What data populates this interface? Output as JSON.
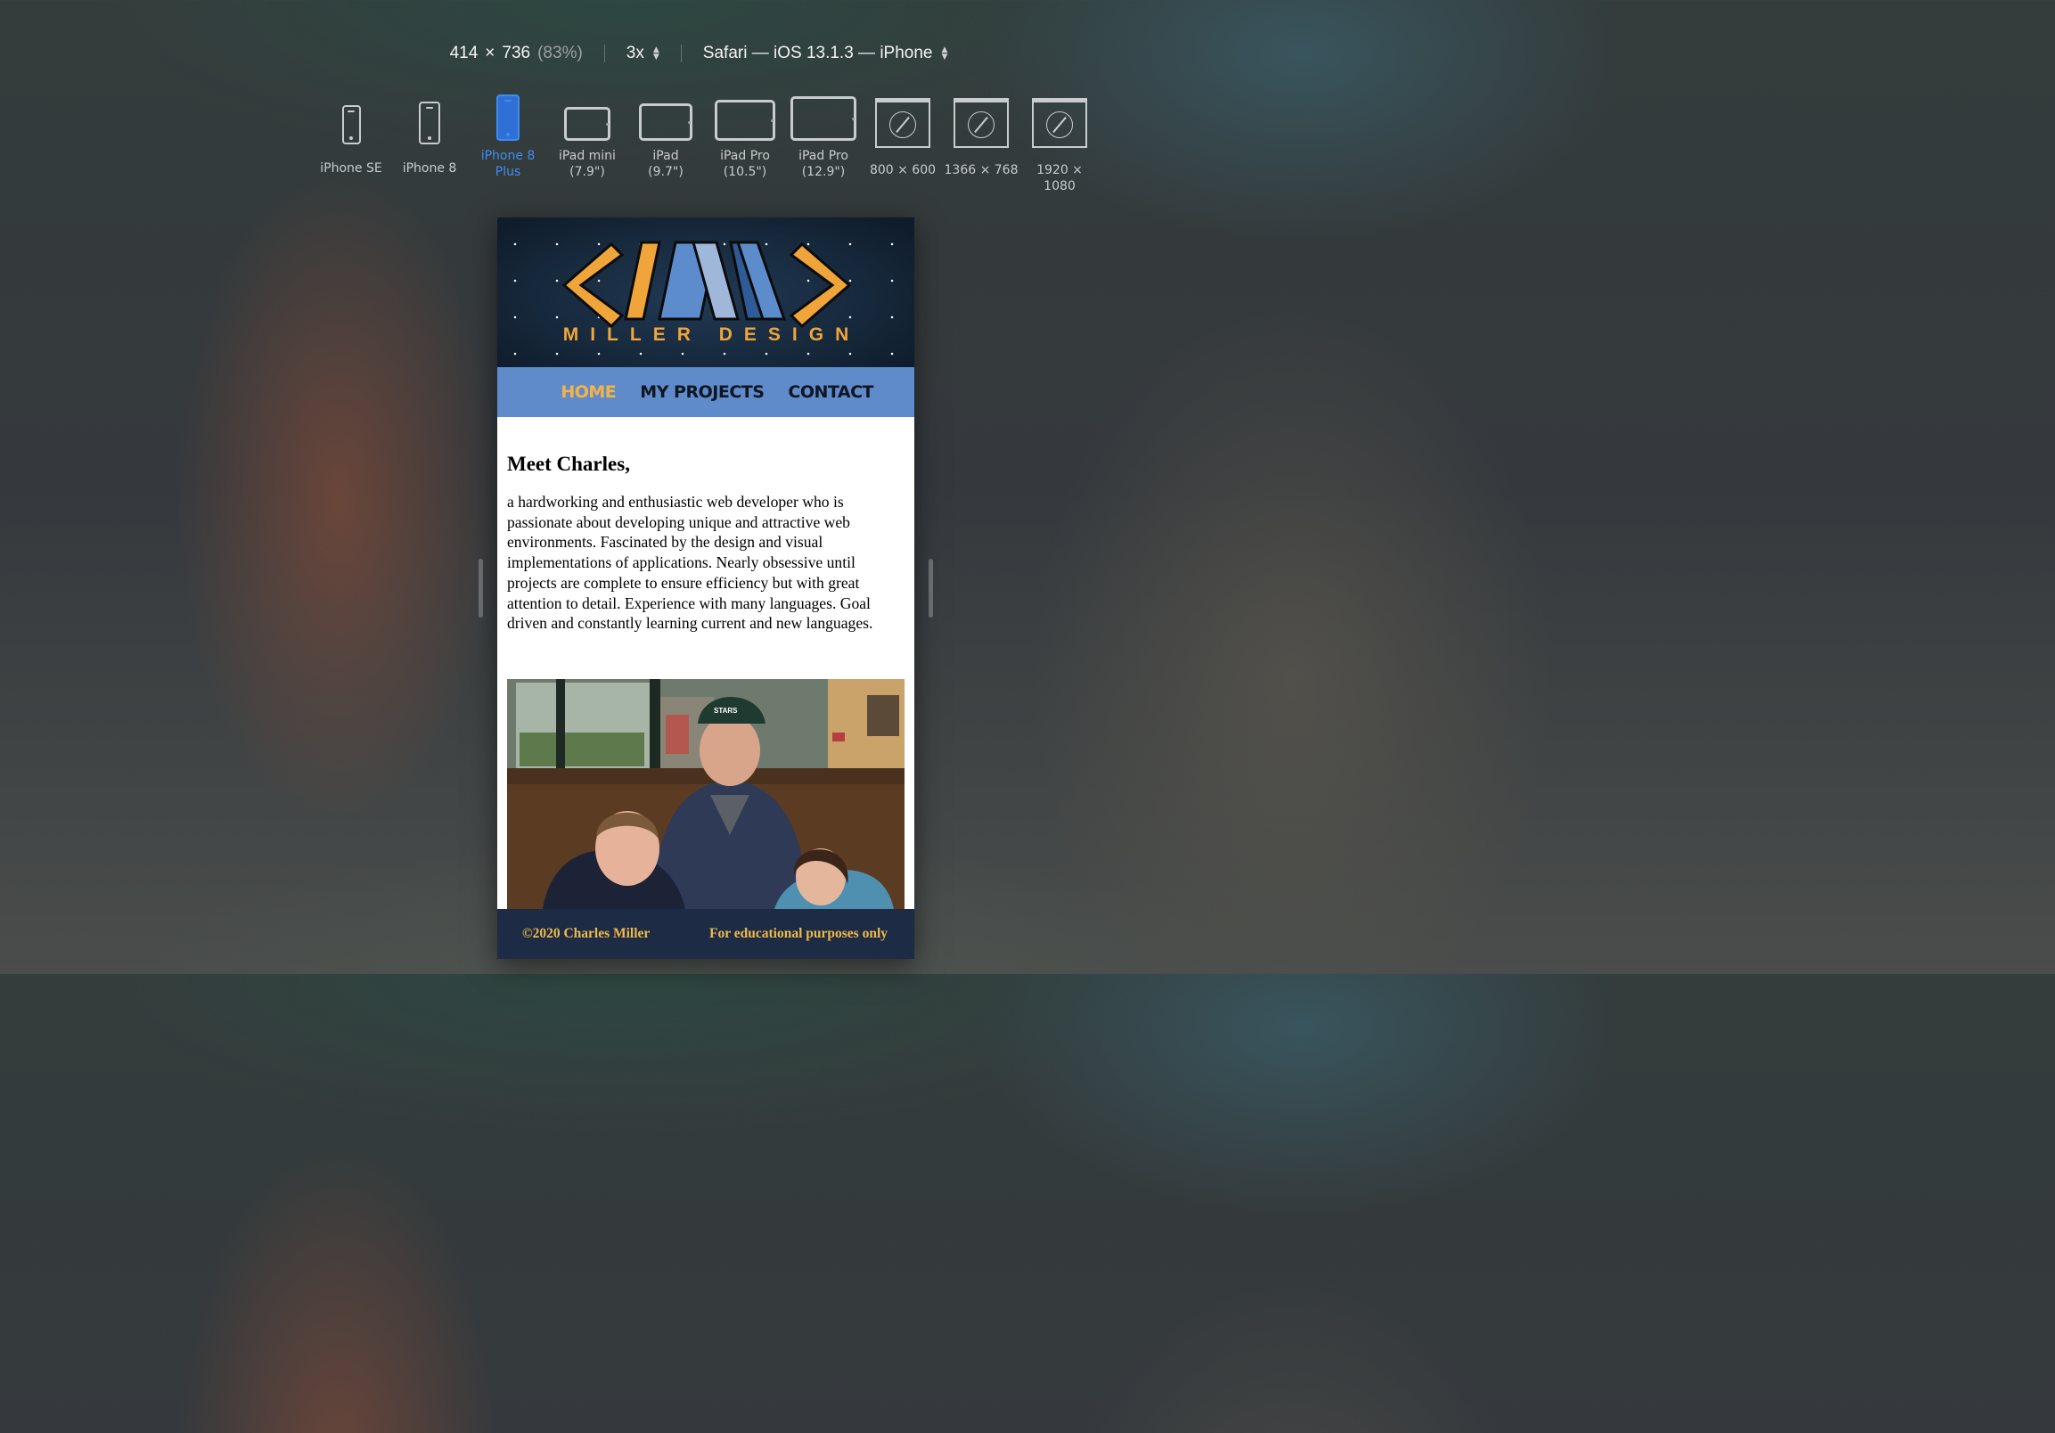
{
  "toolbar": {
    "width": "414",
    "times": "×",
    "height": "736",
    "zoom": "(83%)",
    "scale": "3x",
    "user_agent": "Safari — iOS 13.1.3 — iPhone"
  },
  "devices": [
    {
      "label": "iPhone SE",
      "icon": "phone-icon",
      "selected": false
    },
    {
      "label": "iPhone 8",
      "icon": "phone-icon",
      "selected": false
    },
    {
      "label": "iPhone 8\nPlus",
      "icon": "phone-icon",
      "selected": true
    },
    {
      "label": "iPad mini\n(7.9\")",
      "icon": "tablet-icon",
      "selected": false
    },
    {
      "label": "iPad\n(9.7\")",
      "icon": "tablet-icon",
      "selected": false
    },
    {
      "label": "iPad Pro\n(10.5\")",
      "icon": "tablet-icon",
      "selected": false
    },
    {
      "label": "iPad Pro\n(12.9\")",
      "icon": "tablet-icon",
      "selected": false
    },
    {
      "label": "800 × 600",
      "icon": "safari-window-icon",
      "selected": false
    },
    {
      "label": "1366 × 768",
      "icon": "safari-window-icon",
      "selected": false
    },
    {
      "label": "1920 × 1080",
      "icon": "safari-window-icon",
      "selected": false
    }
  ],
  "site": {
    "brand": "MILLER DESIGN",
    "nav": [
      {
        "label": "HOME",
        "current": true
      },
      {
        "label": "MY PROJECTS",
        "current": false
      },
      {
        "label": "CONTACT",
        "current": false
      }
    ],
    "heading": "Meet Charles,",
    "intro": "a hardworking and enthusiastic web developer who is passionate about developing unique and attractive web environments. Fascinated by the design and visual implementations of applications. Nearly obsessive until projects are complete to ensure efficiency but with great attention to detail. Experience with many languages. Goal driven and constantly learning current and new languages.",
    "photo_cap_text": "STARS",
    "footer": {
      "copyright": "©2020 Charles Miller",
      "notice": "For educational purposes only"
    }
  },
  "colors": {
    "accent_blue": "#3f8cf0",
    "nav_bg": "#5f8bcb",
    "nav_current": "#f4b445",
    "logo_orange": "#f0a53a",
    "footer_bg": "#1d2c44"
  }
}
